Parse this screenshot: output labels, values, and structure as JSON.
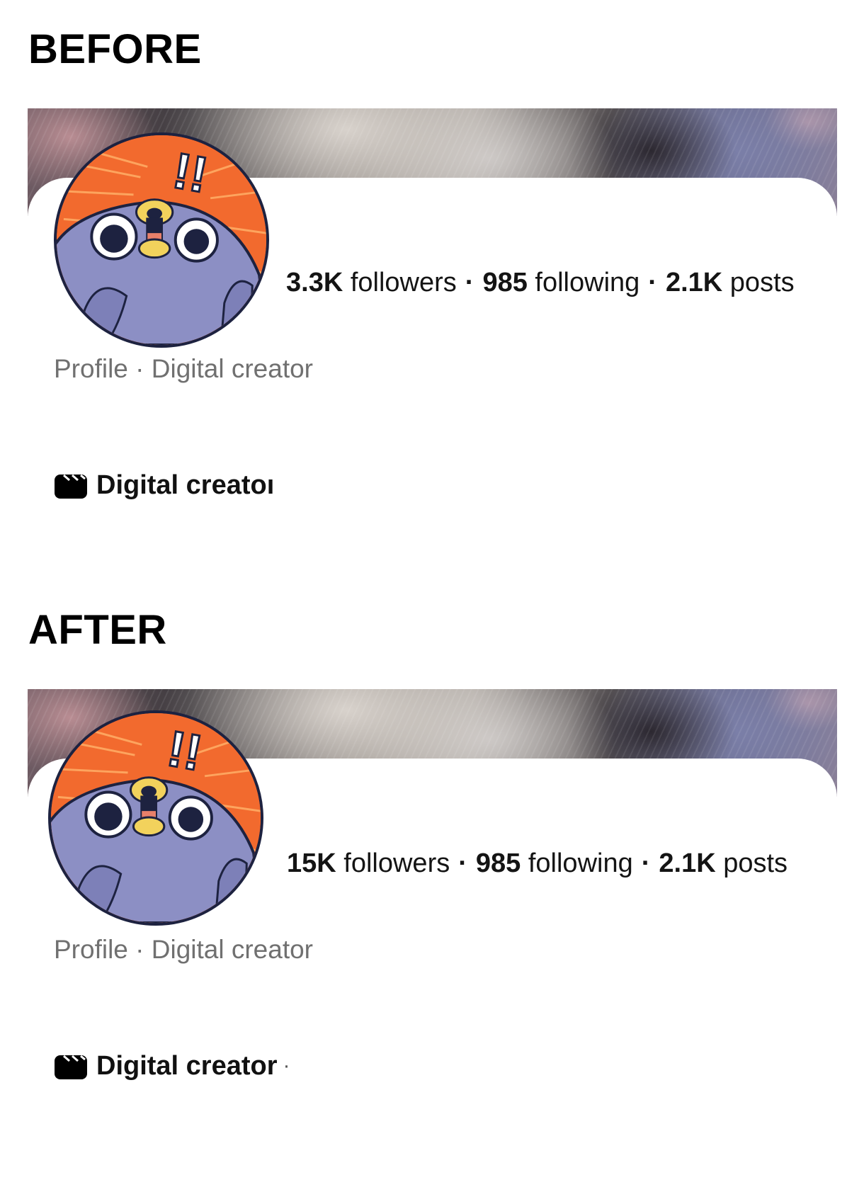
{
  "before": {
    "title": "BEFORE",
    "stats": {
      "followers_count": "3.3K",
      "followers_label": "followers",
      "separator": "·",
      "following_count": "985",
      "following_label": "following",
      "posts_count": "2.1K",
      "posts_label": "posts"
    },
    "profile_line": "Profile · Digital creator",
    "category": {
      "icon": "clapperboard-icon",
      "label": "Digital creatoı",
      "trail": ""
    }
  },
  "after": {
    "title": "AFTER",
    "stats": {
      "followers_count": "15K",
      "followers_label": "followers",
      "separator": "·",
      "following_count": "985",
      "following_label": "following",
      "posts_count": "2.1K",
      "posts_label": "posts"
    },
    "profile_line": "Profile · Digital creator",
    "category": {
      "icon": "clapperboard-icon",
      "label": "Digital creator",
      "trail": "·"
    }
  },
  "avatar": {
    "icon": "shocked-pigeon-avatar",
    "exclamation": "!!"
  },
  "colors": {
    "avatar_background": "#f26a2e",
    "avatar_body": "#8c8fc4",
    "avatar_outline": "#1d2240",
    "beak": "#f2d25c",
    "profile_line_text": "#707070"
  }
}
